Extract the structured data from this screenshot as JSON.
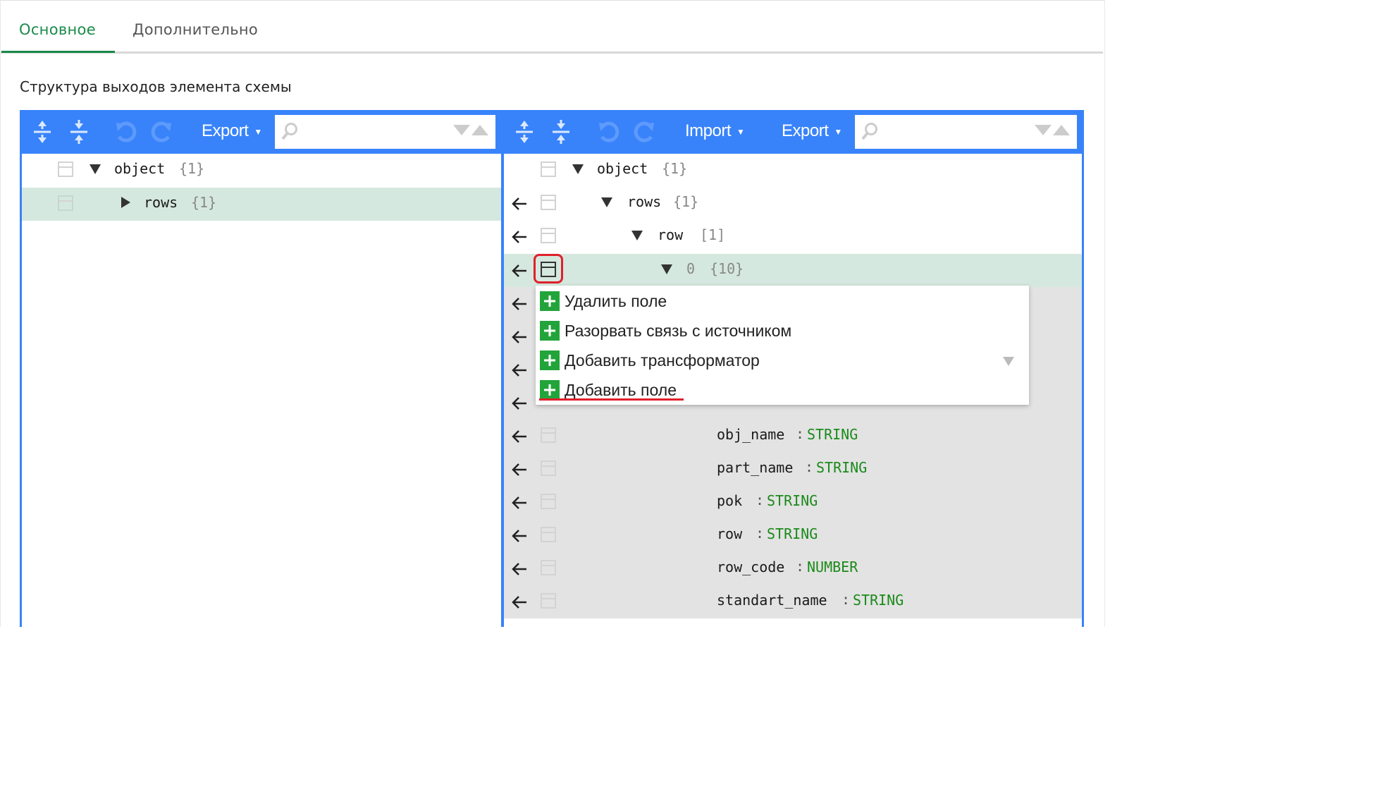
{
  "tabs": {
    "main": "Основное",
    "extra": "Дополнительно"
  },
  "section_title": "Структура выходов элемента схемы",
  "left_panel": {
    "export_label": "Export",
    "search_placeholder": "",
    "rows": [
      {
        "key": "object",
        "count": "{1}"
      },
      {
        "key": "rows",
        "count": "{1}"
      }
    ]
  },
  "right_panel": {
    "import_label": "Import",
    "export_label": "Export",
    "search_placeholder": "",
    "rows": [
      {
        "key": "object",
        "count": "{1}"
      },
      {
        "key": "rows",
        "count": "{1}"
      },
      {
        "key": "row",
        "count": "[1]"
      },
      {
        "key": "0",
        "count": "{10}"
      },
      {
        "key": "obj_name",
        "type": "STRING"
      },
      {
        "key": "part_name",
        "type": "STRING"
      },
      {
        "key": "pok",
        "type": "STRING"
      },
      {
        "key": "row",
        "type": "STRING"
      },
      {
        "key": "row_code",
        "type": "NUMBER"
      },
      {
        "key": "standart_name",
        "type": "STRING"
      }
    ]
  },
  "context_menu": {
    "items": [
      "Удалить поле",
      "Разорвать связь с источником",
      "Добавить трансформатор",
      "Добавить поле"
    ]
  },
  "colors": {
    "accent_blue": "#3883fa",
    "tab_green": "#1a8a4a",
    "selected_row": "#d5e8df",
    "plus_green": "#23a43b",
    "type_green": "#1a8a1a",
    "highlight_red": "#e0202a"
  }
}
